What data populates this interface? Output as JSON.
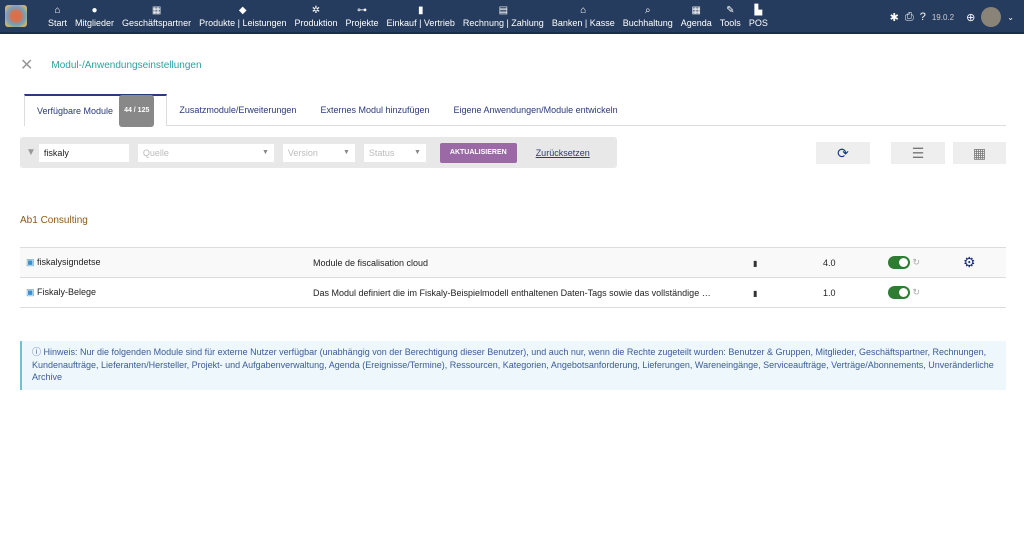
{
  "nav": {
    "items": [
      {
        "icon": "home-icon",
        "glyph": "⌂",
        "label": "Start"
      },
      {
        "icon": "user-icon",
        "glyph": "●",
        "label": "Mitglieder"
      },
      {
        "icon": "building-icon",
        "glyph": "▦",
        "label": "Geschäftspartner"
      },
      {
        "icon": "cube-icon",
        "glyph": "◆",
        "label": "Produkte | Leistungen"
      },
      {
        "icon": "cubes-icon",
        "glyph": "✲",
        "label": "Produktion"
      },
      {
        "icon": "project-icon",
        "glyph": "⊶",
        "label": "Projekte"
      },
      {
        "icon": "briefcase-icon",
        "glyph": "▮",
        "label": "Einkauf | Vertrieb"
      },
      {
        "icon": "invoice-icon",
        "glyph": "▤",
        "label": "Rechnung | Zahlung"
      },
      {
        "icon": "bank-icon",
        "glyph": "⌂",
        "label": "Banken | Kasse"
      },
      {
        "icon": "search-dollar-icon",
        "glyph": "⌕",
        "label": "Buchhaltung"
      },
      {
        "icon": "calendar-icon",
        "glyph": "▦",
        "label": "Agenda"
      },
      {
        "icon": "wrench-icon",
        "glyph": "✎",
        "label": "Tools"
      },
      {
        "icon": "cash-register-icon",
        "glyph": "▙",
        "label": "POS"
      }
    ],
    "version": "19.0.2"
  },
  "page": {
    "title": "Modul-/Anwendungseinstellungen"
  },
  "tabs": [
    {
      "label": "Verfügbare Module",
      "badge": "44 / 125"
    },
    {
      "label": "Zusatzmodule/Erweiterungen"
    },
    {
      "label": "Externes Modul hinzufügen"
    },
    {
      "label": "Eigene Anwendungen/Module entwickeln"
    }
  ],
  "filter": {
    "search": "fiskaly",
    "source_placeholder": "Quelle",
    "version_placeholder": "Version",
    "status_placeholder": "Status",
    "apply": "AKTUALISIEREN",
    "reset": "Zurücksetzen"
  },
  "group": "Ab1 Consulting",
  "modules": [
    {
      "name": "fiskalysigndetse",
      "description": "Module de fiscalisation cloud",
      "version": "4.0",
      "enabled": true
    },
    {
      "name": "Fiskaly-Belege",
      "description": "Das Modul definiert die im Fiskaly-Beispielmodell enthaltenen Daten-Tags sowie das vollständige …",
      "version": "1.0",
      "enabled": true
    }
  ],
  "note": "Hinweis: Nur die folgenden Module sind für externe Nutzer verfügbar (unabhängig von der Berechtigung dieser Benutzer), und auch nur, wenn die Rechte zugeteilt wurden: Benutzer & Gruppen, Mitglieder, Geschäftspartner, Rechnungen, Kundenaufträge, Lieferanten/Hersteller, Projekt- und Aufgabenverwaltung, Agenda (Ereignisse/Termine), Ressourcen, Kategorien, Angebotsanforderung, Lieferungen, Wareneingänge, Serviceaufträge, Verträge/Abonnements, Unveränderliche Archive"
}
